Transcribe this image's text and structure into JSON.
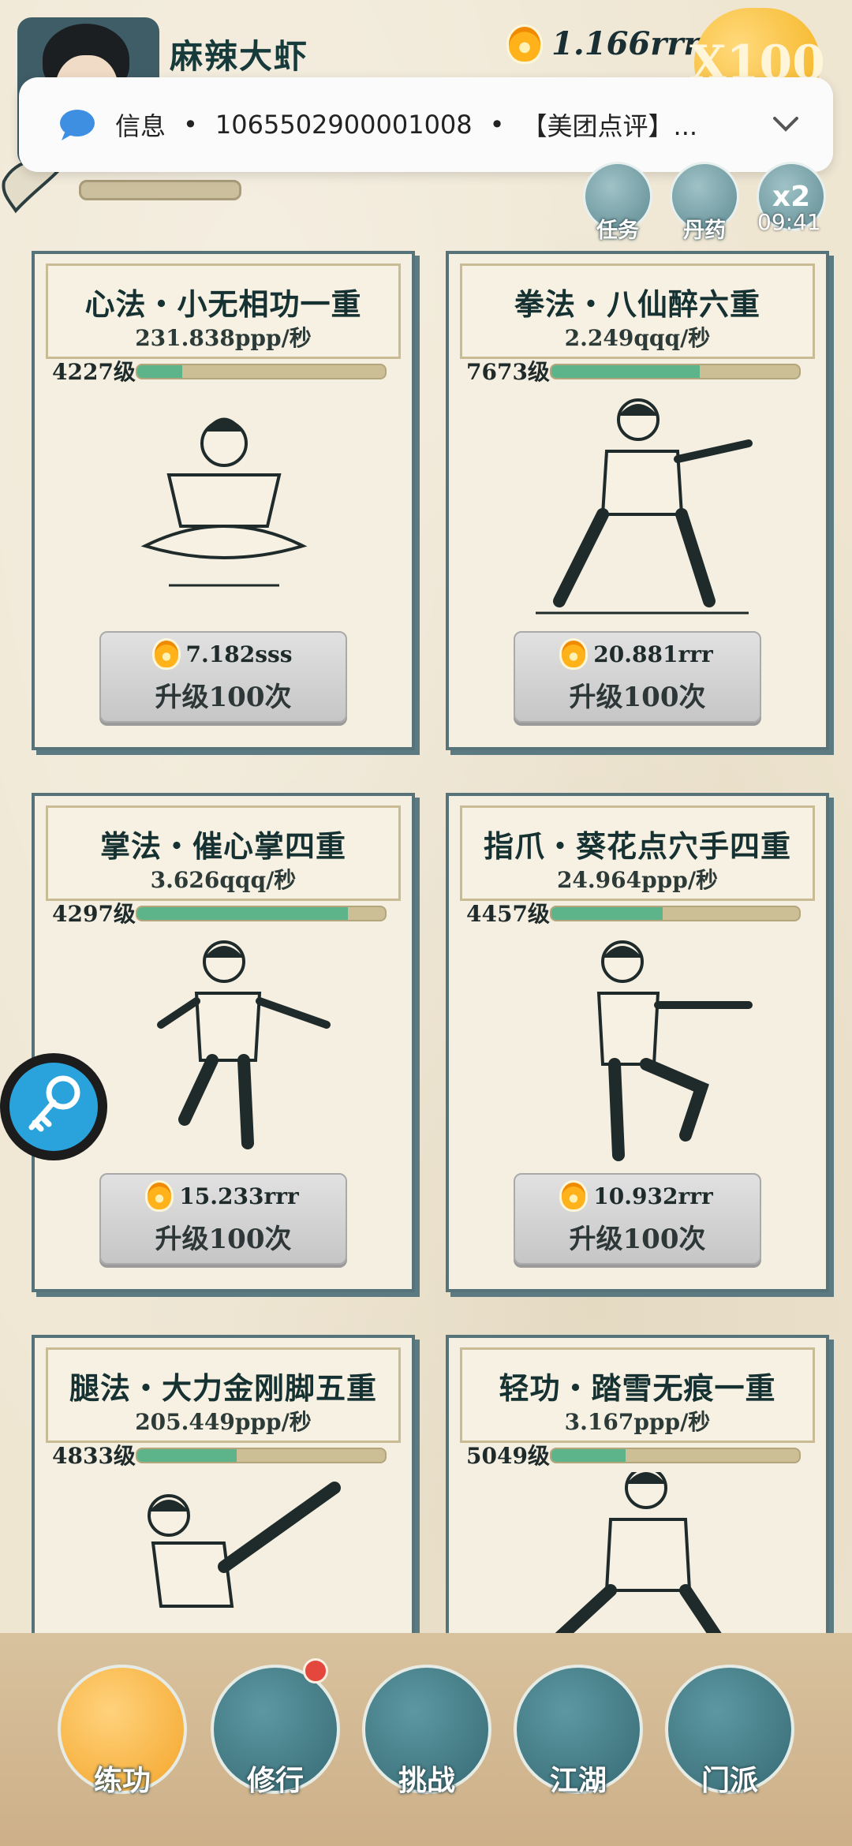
{
  "player": {
    "name": "麻辣大虾"
  },
  "currency": {
    "value": "1.166rrr",
    "icon": "flame-coin-icon"
  },
  "badge": {
    "label": "X100"
  },
  "notification": {
    "app": "信息",
    "dot1": "•",
    "sender": "1065502900001008",
    "dot2": "•",
    "preview": "【美团点评】..."
  },
  "quick_menu": {
    "task": "任务",
    "pill": "丹药",
    "speed": "x2",
    "time": "09:41"
  },
  "cards": [
    {
      "title": "心法・小无相功一重",
      "rate": "231.838ppp/秒",
      "level": "4227级",
      "progress": 0.18,
      "cost": "7.182sss",
      "button": "升级100次"
    },
    {
      "title": "拳法・八仙醉六重",
      "rate": "2.249qqq/秒",
      "level": "7673级",
      "progress": 0.6,
      "cost": "20.881rrr",
      "button": "升级100次"
    },
    {
      "title": "掌法・催心掌四重",
      "rate": "3.626qqq/秒",
      "level": "4297级",
      "progress": 0.85,
      "cost": "15.233rrr",
      "button": "升级100次"
    },
    {
      "title": "指爪・葵花点穴手四重",
      "rate": "24.964ppp/秒",
      "level": "4457级",
      "progress": 0.45,
      "cost": "10.932rrr",
      "button": "升级100次"
    },
    {
      "title": "腿法・大力金刚脚五重",
      "rate": "205.449ppp/秒",
      "level": "4833级",
      "progress": 0.4,
      "cost": "",
      "button": ""
    },
    {
      "title": "轻功・踏雪无痕一重",
      "rate": "3.167ppp/秒",
      "level": "5049级",
      "progress": 0.3,
      "cost": "",
      "button": ""
    }
  ],
  "nav": [
    {
      "label": "练功"
    },
    {
      "label": "修行"
    },
    {
      "label": "挑战"
    },
    {
      "label": "江湖"
    },
    {
      "label": "门派"
    }
  ]
}
